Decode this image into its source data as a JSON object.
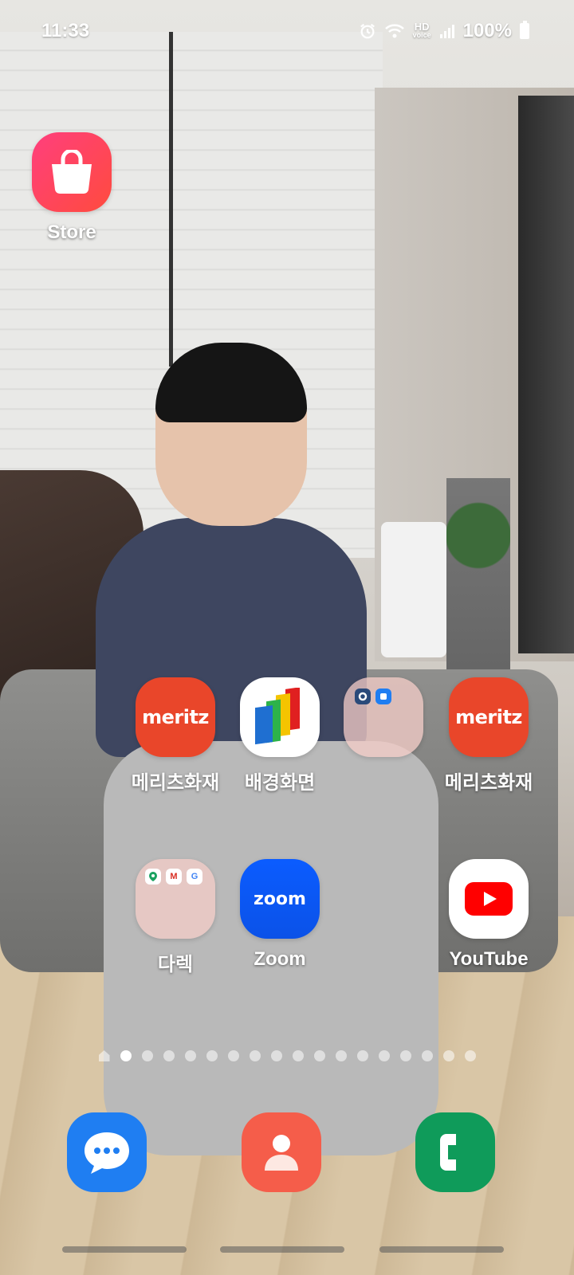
{
  "status_bar": {
    "time": "11:33",
    "hd_voice_top": "HD",
    "hd_voice_bottom": "voice",
    "battery_percent": "100%",
    "icons": [
      "alarm-icon",
      "wifi-icon",
      "hd-voice-icon",
      "signal-icon",
      "battery-icon"
    ]
  },
  "home": {
    "apps": [
      {
        "id": "store",
        "label": "Store",
        "icon": "shopping-bag-icon"
      },
      {
        "id": "meritz1",
        "label": "메리츠화재",
        "icon_text": "meritz"
      },
      {
        "id": "wallpapers",
        "label": "배경화면",
        "icon": "wallpapers-icon"
      },
      {
        "id": "folder1",
        "label": "",
        "icon": "folder-icon"
      },
      {
        "id": "meritz2",
        "label": "메리츠화재",
        "icon_text": "meritz"
      },
      {
        "id": "folder2",
        "label": "다렉",
        "icon": "folder-icon"
      },
      {
        "id": "zoom",
        "label": "Zoom",
        "icon_text": "zoom"
      },
      {
        "id": "youtube",
        "label": "YouTube",
        "icon": "youtube-icon"
      }
    ],
    "folder2_mini": {
      "gmail": "M",
      "google": "G"
    }
  },
  "page_indicator": {
    "total_pages": 17,
    "active_page": 1,
    "has_home_page": true
  },
  "dock": [
    {
      "id": "messages",
      "icon": "messages-icon"
    },
    {
      "id": "contacts",
      "icon": "contacts-icon"
    },
    {
      "id": "phone",
      "icon": "phone-icon"
    }
  ],
  "colors": {
    "store_accent": "#ff3f7d",
    "meritz": "#e9462a",
    "zoom": "#0b5cff",
    "youtube_red": "#ff0000",
    "messages": "#1f7ef2",
    "contacts": "#f55d4a",
    "phone": "#0f9b5a"
  }
}
